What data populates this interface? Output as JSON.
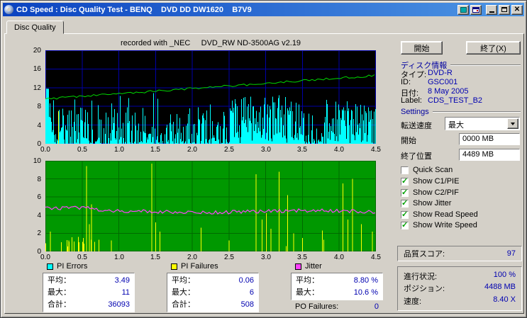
{
  "colors": {
    "titlebar_left": "#0a42c0",
    "titlebar_right": "#4e96e4",
    "chrome": "#d4d0c8",
    "value_text": "#0000b0",
    "section_title": "#0000a0",
    "pi_errors": "#00ffff",
    "pi_failures": "#ffff00",
    "jitter": "#ff40ff",
    "speed_line": "#00d800",
    "check_green": "#00a000",
    "chart1_bg": "#000000",
    "chart1_grid": "#0000a8",
    "chart2_bg": "#009800",
    "chart2_grid": "#006a00"
  },
  "window": {
    "title": "CD Speed : Disc Quality Test - BENQ    DVD DD DW1620    B7V9",
    "tab_label": "Disc Quality"
  },
  "chart_header": "recorded with _NEC     DVD_RW ND-3500AG v2.19",
  "chart_data": [
    {
      "type": "area",
      "title": "PI Errors and write speed vs disc position (GB)",
      "x_ticks": [
        "0.0",
        "0.5",
        "1.0",
        "1.5",
        "2.0",
        "2.5",
        "3.0",
        "3.5",
        "4.0",
        "4.5"
      ],
      "y_ticks": [
        "20",
        "16",
        "12",
        "8",
        "4",
        "0"
      ],
      "xlim": [
        0,
        4.5
      ],
      "ylim": [
        0,
        20
      ],
      "grid": true,
      "series": [
        {
          "name": "PI Errors",
          "color": "#00ffff",
          "average": 3.49,
          "maximum": 11,
          "total": 36093
        },
        {
          "name": "Write Speed",
          "color": "#00d800",
          "start_value": 9.6,
          "end_value": 14.6
        }
      ]
    },
    {
      "type": "area",
      "title": "PI Failures and Jitter vs disc position (GB)",
      "x_ticks": [
        "0.0",
        "0.5",
        "1.0",
        "1.5",
        "2.0",
        "2.5",
        "3.0",
        "3.5",
        "4.0",
        "4.5"
      ],
      "y_ticks": [
        "10",
        "8",
        "6",
        "4",
        "2",
        "0"
      ],
      "xlim": [
        0,
        4.5
      ],
      "ylim": [
        0,
        10
      ],
      "grid": true,
      "series": [
        {
          "name": "PI Failures",
          "color": "#ffff00",
          "average": 0.06,
          "maximum": 6,
          "total": 508,
          "spikes": [
            [
              0.07,
              2.2
            ],
            [
              0.32,
              1.2
            ],
            [
              0.45,
              1.6
            ],
            [
              0.56,
              9.4
            ],
            [
              0.6,
              3.0
            ],
            [
              0.63,
              5.2
            ],
            [
              0.9,
              1.2
            ],
            [
              1.45,
              9.7
            ],
            [
              1.5,
              3.2
            ],
            [
              1.56,
              2.2
            ],
            [
              2.12,
              2.6
            ],
            [
              2.5,
              1.2
            ],
            [
              2.87,
              8.5
            ],
            [
              2.95,
              3.5
            ],
            [
              3.01,
              4.2
            ],
            [
              3.07,
              2.5
            ],
            [
              3.18,
              8.8
            ],
            [
              3.3,
              6.2
            ],
            [
              3.38,
              2.0
            ],
            [
              3.5,
              1.5
            ],
            [
              3.77,
              2.3
            ],
            [
              4.05,
              7.5
            ],
            [
              4.12,
              3.5
            ],
            [
              4.18,
              8.0
            ],
            [
              4.3,
              3.0
            ],
            [
              4.45,
              2.2
            ]
          ]
        },
        {
          "name": "Jitter",
          "color": "#ff40ff",
          "average_pct": 8.8,
          "maximum_pct": 10.6,
          "plot_level": 4.4
        }
      ]
    }
  ],
  "stats": {
    "pi_errors": {
      "label": "PI Errors",
      "color": "#00ffff",
      "avg_label": "平均：",
      "avg": "3.49",
      "max_label": "最大：",
      "max": "11",
      "total_label": "合計：",
      "total": "36093"
    },
    "pi_failures": {
      "label": "PI Failures",
      "color": "#ffff00",
      "avg_label": "平均：",
      "avg": "0.06",
      "max_label": "最大：",
      "max": "6",
      "total_label": "合計：",
      "total": "508"
    },
    "jitter": {
      "label": "Jitter",
      "color": "#ff40ff",
      "avg_label": "平均：",
      "avg": "8.80 %",
      "max_label": "最大：",
      "max": "10.6 %",
      "po_label": "PO Failures:",
      "po": "0"
    }
  },
  "panel": {
    "start_button": "開始",
    "exit_button": "終了(X)",
    "disc_info_title": "ディスク情報",
    "disc_info": [
      {
        "label": "タイプ:",
        "value": "DVD-R"
      },
      {
        "label": "ID:",
        "value": "GSC001"
      },
      {
        "label": "日付:",
        "value": "8 May 2005"
      },
      {
        "label": "Label:",
        "value": "CDS_TEST_B2"
      }
    ],
    "settings_title": "Settings",
    "speed_label": "転送速度",
    "speed_value": "最大",
    "start_label": "開始",
    "start_value": "0000 MB",
    "end_label": "終了位置",
    "end_value": "4489 MB",
    "checkboxes": [
      {
        "label": "Quick Scan",
        "checked": false
      },
      {
        "label": "Show C1/PIE",
        "checked": true
      },
      {
        "label": "Show C2/PIF",
        "checked": true
      },
      {
        "label": "Show Jitter",
        "checked": true
      },
      {
        "label": "Show Read Speed",
        "checked": true
      },
      {
        "label": "Show Write Speed",
        "checked": true
      }
    ],
    "score_label": "品質スコア:",
    "score_value": "97",
    "progress": [
      {
        "label": "進行状況:",
        "value": "100 %"
      },
      {
        "label": "ポジション:",
        "value": "4488 MB"
      },
      {
        "label": "速度:",
        "value": "8.40 X"
      }
    ]
  }
}
